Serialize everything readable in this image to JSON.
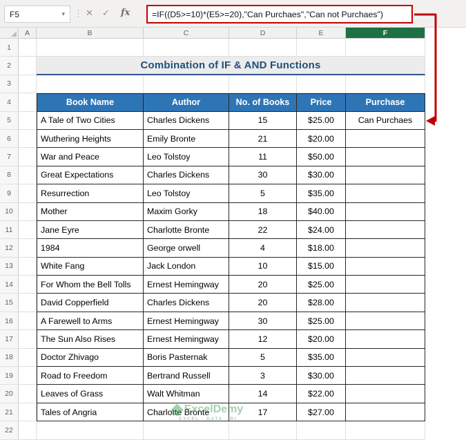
{
  "formula_bar": {
    "name_box_value": "F5",
    "cancel_label": "✕",
    "enter_label": "✓",
    "fx_label": "fx",
    "formula": "=IF((D5>=10)*(E5>=20),\"Can Purchaes\",\"Can not Purchaes\")"
  },
  "sheet": {
    "column_letters": [
      "A",
      "B",
      "C",
      "D",
      "E",
      "F"
    ],
    "selected_column": "F",
    "selected_cell": "F5",
    "row_numbers": [
      "1",
      "2",
      "3",
      "4",
      "5",
      "6",
      "7",
      "8",
      "9",
      "10",
      "11",
      "12",
      "13",
      "14",
      "15",
      "16",
      "17",
      "18",
      "19",
      "20",
      "21",
      "22"
    ],
    "title": "Combination of IF & AND Functions",
    "title_row": 2,
    "header_row": 4,
    "data_start_row": 5
  },
  "table": {
    "headers": [
      "Book Name",
      "Author",
      "No. of Books",
      "Price",
      "Purchase"
    ],
    "rows": [
      [
        "A Tale of Two Cities",
        "Charles Dickens",
        "15",
        "$25.00",
        "Can Purchaes"
      ],
      [
        "Wuthering Heights",
        "Emily Bronte",
        "21",
        "$20.00",
        ""
      ],
      [
        "War and Peace",
        "Leo Tolstoy",
        "11",
        "$50.00",
        ""
      ],
      [
        "Great Expectations",
        "Charles Dickens",
        "30",
        "$30.00",
        ""
      ],
      [
        "Resurrection",
        "Leo Tolstoy",
        "5",
        "$35.00",
        ""
      ],
      [
        "Mother",
        "Maxim Gorky",
        "18",
        "$40.00",
        ""
      ],
      [
        "Jane Eyre",
        "Charlotte Bronte",
        "22",
        "$24.00",
        ""
      ],
      [
        "1984",
        "George orwell",
        "4",
        "$18.00",
        ""
      ],
      [
        "White Fang",
        "Jack London",
        "10",
        "$15.00",
        ""
      ],
      [
        "For Whom the Bell Tolls",
        "Ernest Hemingway",
        "20",
        "$25.00",
        ""
      ],
      [
        "David Copperfield",
        "Charles Dickens",
        "20",
        "$28.00",
        ""
      ],
      [
        "A Farewell to Arms",
        "Ernest Hemingway",
        "30",
        "$25.00",
        ""
      ],
      [
        "The Sun Also Rises",
        "Ernest Hemingway",
        "12",
        "$20.00",
        ""
      ],
      [
        "Doctor Zhivago",
        "Boris Pasternak",
        "5",
        "$35.00",
        ""
      ],
      [
        "Road to Freedom",
        "Bertrand Russell",
        "3",
        "$30.00",
        ""
      ],
      [
        "Leaves of Grass",
        "Walt Whitman",
        "14",
        "$22.00",
        ""
      ],
      [
        "Tales of Angria",
        "Charlotte Bronte",
        "17",
        "$27.00",
        ""
      ]
    ]
  },
  "watermark": {
    "brand": "ExcelDemy",
    "tagline": "EXCEL · DATA · BI"
  },
  "colors": {
    "table_header_bg": "#2e75b6",
    "selected_column_bg": "#1f7145",
    "highlight_red": "#c00000",
    "title_text": "#1f4e79",
    "title_underline": "#31538f",
    "watermark_green": "#4ba05f"
  }
}
